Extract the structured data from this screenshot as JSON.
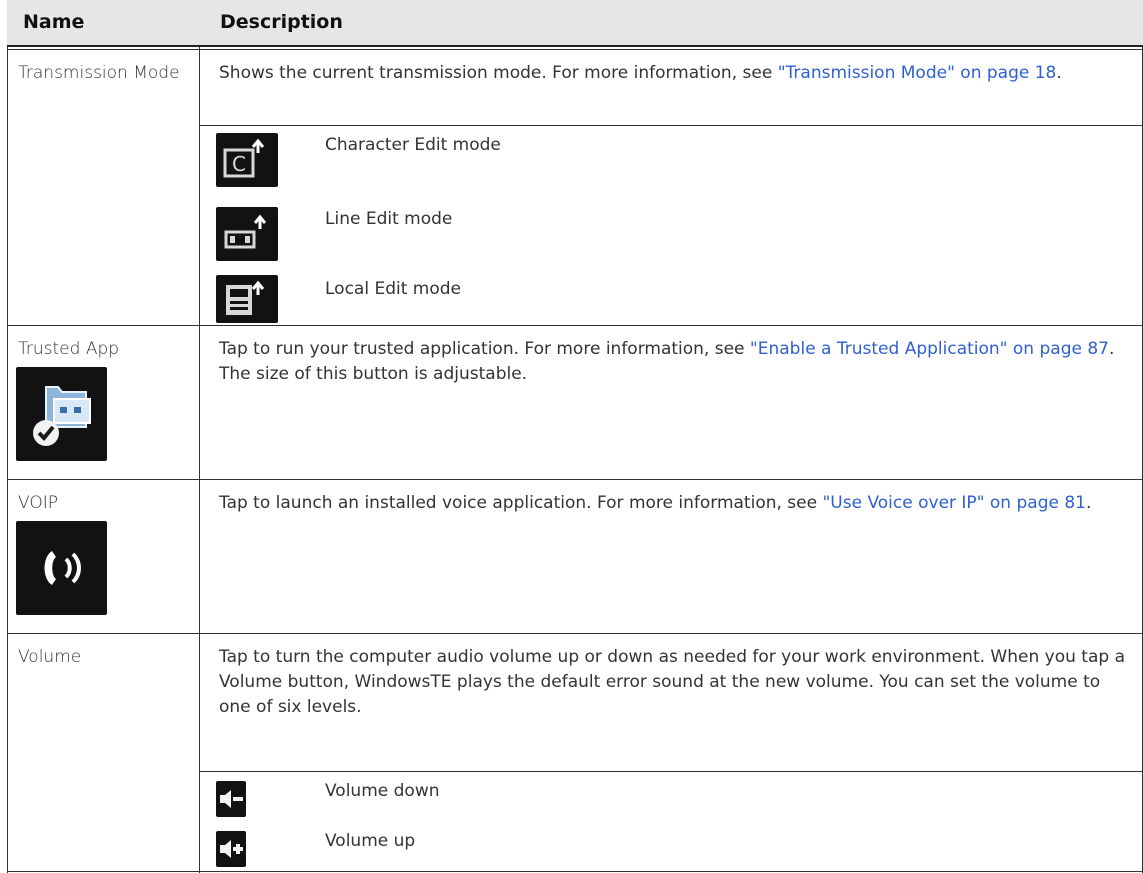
{
  "table": {
    "headers": {
      "name": "Name",
      "description": "Description"
    },
    "rows": [
      {
        "name": "Transmission Mode",
        "description_pre": "Shows the current transmission mode. For more information, see ",
        "description_link": "\"Transmission Mode\" on page 18",
        "description_post": ".",
        "sub_items": [
          {
            "label": "Character Edit mode",
            "icon": "character-edit-mode-icon"
          },
          {
            "label": "Line Edit mode",
            "icon": "line-edit-mode-icon"
          },
          {
            "label": "Local Edit mode",
            "icon": "local-edit-mode-icon"
          }
        ]
      },
      {
        "name": "Trusted App",
        "icon": "trusted-app-icon",
        "description_pre": "Tap to run your trusted application. For more information, see ",
        "description_link": "\"Enable a Trusted Application\" on page 87",
        "description_post": ". The size of this button is adjustable."
      },
      {
        "name": "VOIP",
        "icon": "voip-phone-icon",
        "description_pre": "Tap to launch an installed voice application. For more information, see ",
        "description_link": "\"Use Voice over IP\" on page 81",
        "description_post": "."
      },
      {
        "name": "Volume",
        "description": "Tap to turn the computer audio volume up or down as needed for your work environment. When you tap a Volume button, WindowsTE plays the default error sound at the new volume. You can set the volume to one of six levels.",
        "sub_items": [
          {
            "label": "Volume down",
            "icon": "volume-down-icon"
          },
          {
            "label": "Volume up",
            "icon": "volume-up-icon"
          }
        ]
      }
    ]
  },
  "colors": {
    "link": "#2f5fd0",
    "header_bg": "#e6e6e6",
    "icon_bg": "#121212"
  }
}
